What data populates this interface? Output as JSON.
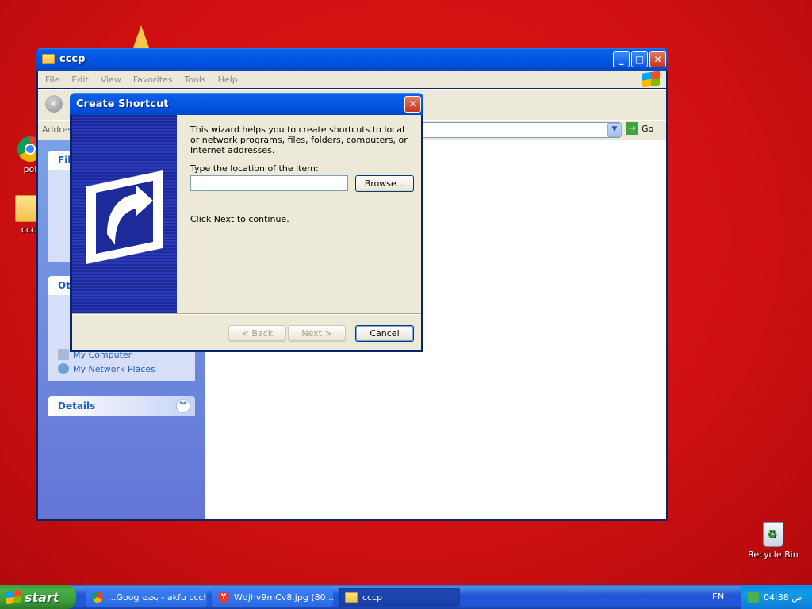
{
  "desktop": {
    "icons": [
      {
        "label": "poi"
      },
      {
        "label": "ccc"
      },
      {
        "label": "Recycle Bin"
      }
    ]
  },
  "explorer": {
    "title": "cccp",
    "menu": [
      "File",
      "Edit",
      "View",
      "Favorites",
      "Tools",
      "Help"
    ],
    "address_label": "Addres",
    "go_label": "Go",
    "tasks": {
      "file_header": "File",
      "other_header": "Ot",
      "other_links": [
        "My Computer",
        "My Network Places"
      ],
      "details_header": "Details"
    }
  },
  "dialog": {
    "title": "Create Shortcut",
    "intro": "This wizard helps you to create shortcuts to local or network programs, files, folders, computers, or Internet addresses.",
    "location_label": "Type the location of the item:",
    "location_value": "",
    "browse_label": "Browse...",
    "continue_text": "Click Next to continue.",
    "back_label": "< Back",
    "next_label": "Next >",
    "cancel_label": "Cancel"
  },
  "taskbar": {
    "start_label": "start",
    "buttons": [
      {
        "label": "...Goog بحث - akfu ccch",
        "icon": "chrome-icon"
      },
      {
        "label": "Wdjhv9mCv8.jpg (80...",
        "icon": "yandex-icon"
      },
      {
        "label": "cccp",
        "icon": "folder-icon"
      }
    ],
    "language": "EN",
    "clock": "ص 04:38"
  },
  "colors": {
    "desktop_red": "#d10f13",
    "xp_blue": "#0054e3",
    "start_green": "#3a9a3a"
  }
}
